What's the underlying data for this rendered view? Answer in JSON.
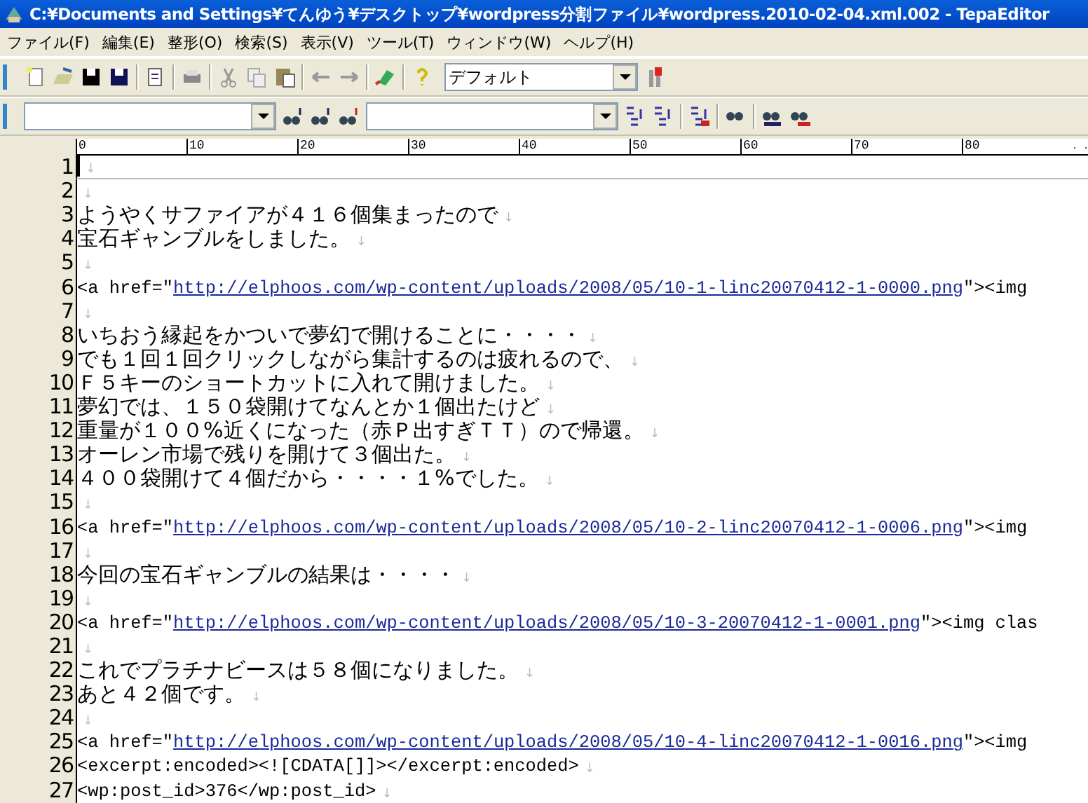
{
  "window": {
    "title": "C:¥Documents and Settings¥てんゆう¥デスクトップ¥wordpress分割ファイル¥wordpress.2010-02-04.xml.002 - TepaEditor"
  },
  "menu": [
    "ファイル(F)",
    "編集(E)",
    "整形(O)",
    "検索(S)",
    "表示(V)",
    "ツール(T)",
    "ウィンドウ(W)",
    "ヘルプ(H)"
  ],
  "toolbar": {
    "style_combo": {
      "value": "デフォルト"
    }
  },
  "ruler": {
    "labels": [
      "0",
      "10",
      "20",
      "30",
      "40",
      "50",
      "60",
      "70",
      "80"
    ]
  },
  "lines": [
    {
      "number": "1",
      "kind": "blank",
      "current": true,
      "eol": "↓"
    },
    {
      "number": "2",
      "kind": "blank",
      "current": false,
      "eol": "↓"
    },
    {
      "number": "3",
      "kind": "text",
      "current": false,
      "text": "ようやくサファイアが４１６個集まったので",
      "eol": "↓"
    },
    {
      "number": "4",
      "kind": "text",
      "current": false,
      "text": "宝石ギャンブルをしました。",
      "eol": "↓"
    },
    {
      "number": "5",
      "kind": "blank",
      "current": false,
      "eol": "↓"
    },
    {
      "number": "6",
      "kind": "link",
      "current": false,
      "before": "<a href=\"",
      "url": "http://elphoos.com/wp-content/uploads/2008/05/10-1-linc20070412-1-0000.png",
      "after": "\"><img"
    },
    {
      "number": "7",
      "kind": "blank",
      "current": false,
      "eol": "↓"
    },
    {
      "number": "8",
      "kind": "text",
      "current": false,
      "text": "いちおう縁起をかついで夢幻で開けることに・・・・",
      "eol": "↓"
    },
    {
      "number": "9",
      "kind": "text",
      "current": false,
      "text": "でも１回１回クリックしながら集計するのは疲れるので、",
      "eol": "↓"
    },
    {
      "number": "10",
      "kind": "text",
      "current": false,
      "text": "Ｆ５キーのショートカットに入れて開けました。",
      "eol": "↓"
    },
    {
      "number": "11",
      "kind": "text",
      "current": false,
      "text": "夢幻では、１５０袋開けてなんとか１個出たけど",
      "eol": "↓"
    },
    {
      "number": "12",
      "kind": "text",
      "current": false,
      "text": "重量が１００%近くになった（赤Ｐ出すぎＴＴ）ので帰還。",
      "eol": "↓"
    },
    {
      "number": "13",
      "kind": "text",
      "current": false,
      "text": "オーレン市場で残りを開けて３個出た。",
      "eol": "↓"
    },
    {
      "number": "14",
      "kind": "text",
      "current": false,
      "text": "４００袋開けて４個だから・・・・１%でした。",
      "eol": "↓"
    },
    {
      "number": "15",
      "kind": "blank",
      "current": false,
      "eol": "↓"
    },
    {
      "number": "16",
      "kind": "link",
      "current": false,
      "before": "<a href=\"",
      "url": "http://elphoos.com/wp-content/uploads/2008/05/10-2-linc20070412-1-0006.png",
      "after": "\"><img"
    },
    {
      "number": "17",
      "kind": "blank",
      "current": false,
      "eol": "↓"
    },
    {
      "number": "18",
      "kind": "text",
      "current": false,
      "text": "今回の宝石ギャンブルの結果は・・・・",
      "eol": "↓"
    },
    {
      "number": "19",
      "kind": "blank",
      "current": false,
      "eol": "↓"
    },
    {
      "number": "20",
      "kind": "link",
      "current": false,
      "before": "<a href=\"",
      "url": "http://elphoos.com/wp-content/uploads/2008/05/10-3-20070412-1-0001.png",
      "after": "\"><img clas"
    },
    {
      "number": "21",
      "kind": "blank",
      "current": false,
      "eol": "↓"
    },
    {
      "number": "22",
      "kind": "text",
      "current": false,
      "text": "これでプラチナビースは５８個になりました。",
      "eol": "↓"
    },
    {
      "number": "23",
      "kind": "text",
      "current": false,
      "text": "あと４２個です。",
      "eol": "↓"
    },
    {
      "number": "24",
      "kind": "blank",
      "current": false,
      "eol": "↓"
    },
    {
      "number": "25",
      "kind": "link",
      "current": false,
      "before": "<a href=\"",
      "url": "http://elphoos.com/wp-content/uploads/2008/05/10-4-linc20070412-1-0016.png",
      "after": "\"><img"
    },
    {
      "number": "26",
      "kind": "code",
      "current": false,
      "text": "<excerpt:encoded><![CDATA[]]></excerpt:encoded>",
      "eol": "↓"
    },
    {
      "number": "27",
      "kind": "code",
      "current": false,
      "text": "<wp:post_id>376</wp:post_id>",
      "eol": "↓"
    }
  ]
}
